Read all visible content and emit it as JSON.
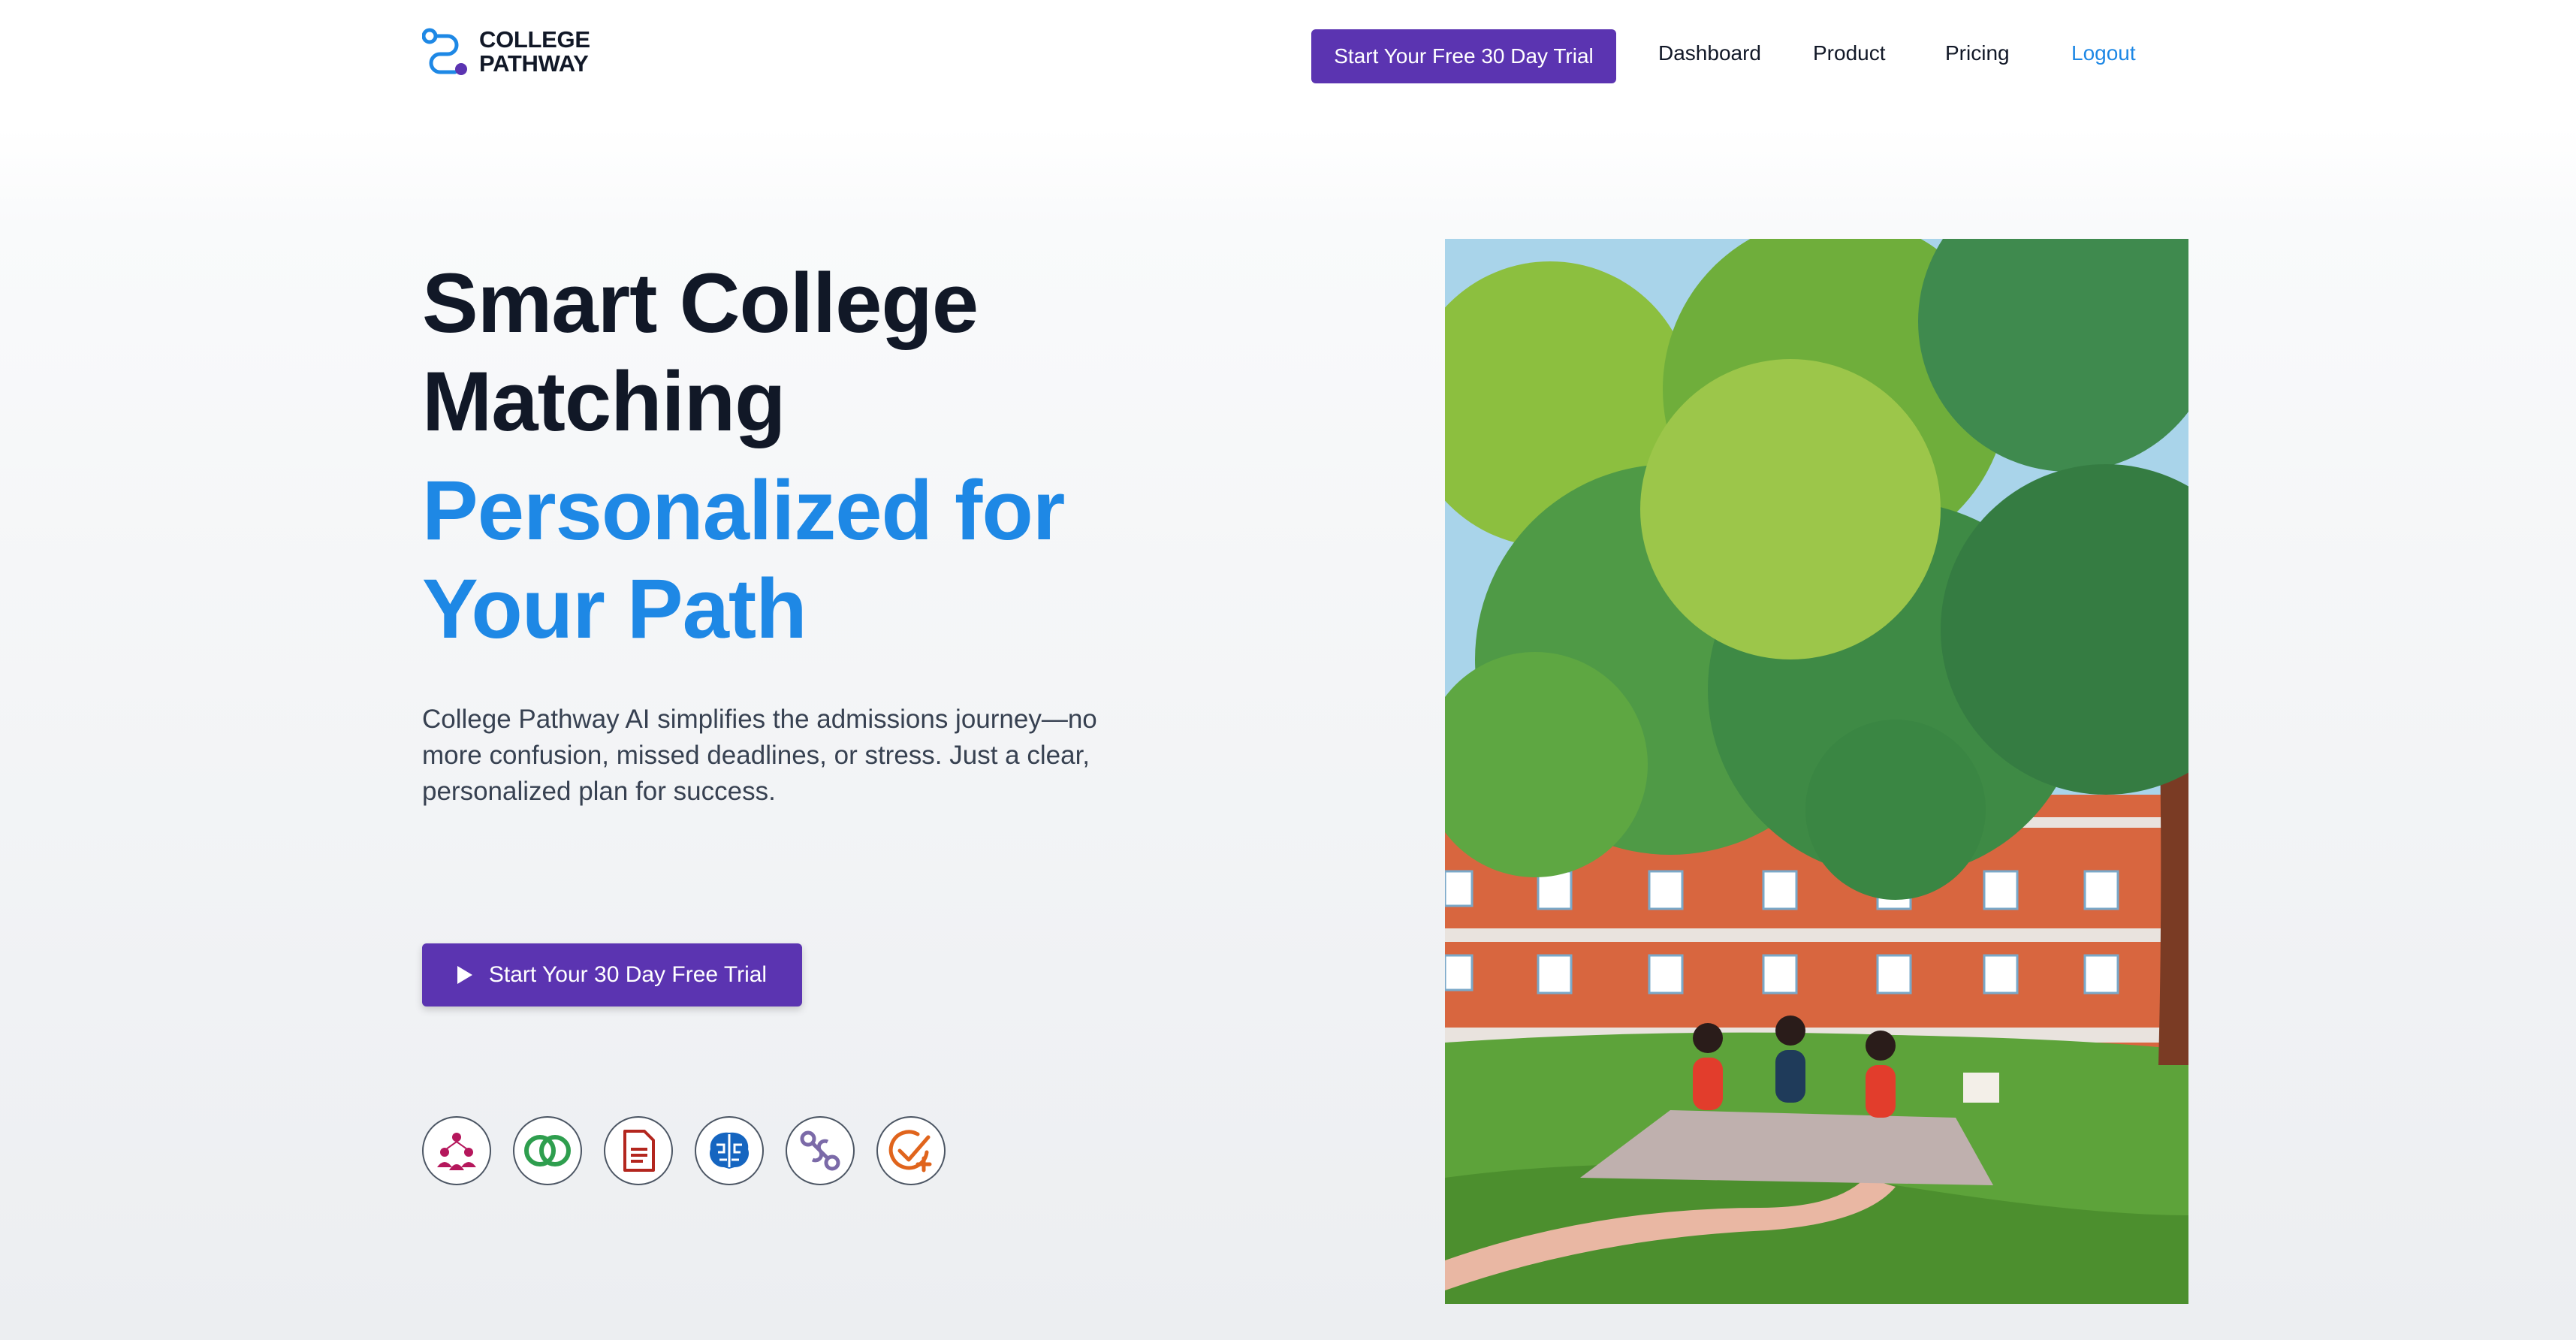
{
  "header": {
    "logo": {
      "line1": "COLLEGE",
      "line2": "PATHWAY",
      "icon": "path-logo-icon"
    },
    "cta_label": "Start Your Free 30 Day Trial",
    "nav": [
      {
        "label": "Dashboard"
      },
      {
        "label": "Product"
      },
      {
        "label": "Pricing"
      },
      {
        "label": "Logout"
      }
    ]
  },
  "hero": {
    "title_line1": "Smart College",
    "title_line2": "Matching",
    "subtitle_line1": "Personalized for",
    "subtitle_line2": "Your Path",
    "description": "College Pathway AI simplifies the admissions journey—no more confusion, missed deadlines, or stress. Just a clear, personalized plan for success.",
    "cta_label": "Start Your 30 Day Free Trial",
    "cta_icon": "play-icon"
  },
  "feature_icons": [
    {
      "name": "people-network-icon",
      "color": "#b5175c"
    },
    {
      "name": "overlap-circles-icon",
      "color": "#2e9e4e"
    },
    {
      "name": "document-icon",
      "color": "#b3261e"
    },
    {
      "name": "brain-icon",
      "color": "#1565c0"
    },
    {
      "name": "path-icon",
      "color": "#7b6aa8"
    },
    {
      "name": "check-plus-icon",
      "color": "#e0641c"
    }
  ],
  "colors": {
    "primary": "#5b34b1",
    "accent_blue": "#1e88e5",
    "text_dark": "#111827",
    "text_body": "#374151"
  }
}
